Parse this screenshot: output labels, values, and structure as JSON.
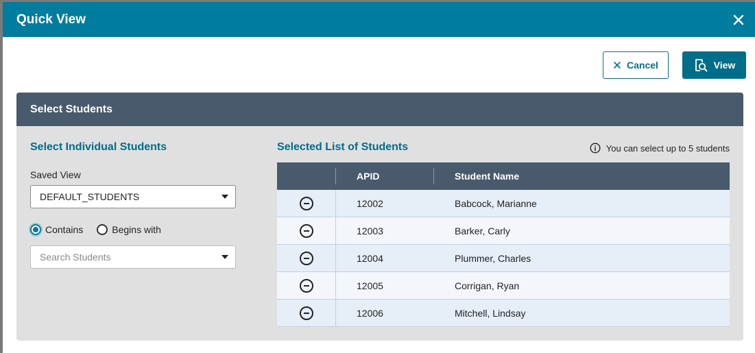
{
  "modal": {
    "title": "Quick View",
    "close_icon": "close-icon"
  },
  "toolbar": {
    "cancel_label": "Cancel",
    "view_label": "View"
  },
  "panel": {
    "header": "Select Students",
    "left": {
      "title": "Select Individual Students",
      "saved_view_label": "Saved View",
      "saved_view_value": "DEFAULT_STUDENTS",
      "radio_contains": "Contains",
      "radio_begins_with": "Begins with",
      "selected_radio": "Contains",
      "search_placeholder": "Search Students"
    },
    "right": {
      "title": "Selected List of Students",
      "info_note": "You can select up to 5 students",
      "columns": [
        "",
        "APID",
        "Student Name"
      ],
      "rows": [
        {
          "apid": "12002",
          "name": "Babcock, Marianne"
        },
        {
          "apid": "12003",
          "name": "Barker, Carly"
        },
        {
          "apid": "12004",
          "name": "Plummer, Charles"
        },
        {
          "apid": "12005",
          "name": "Corrigan, Ryan"
        },
        {
          "apid": "12006",
          "name": "Mitchell, Lindsay"
        }
      ]
    }
  },
  "colors": {
    "accent": "#007c9e",
    "header_dark": "#485a6c",
    "panel_bg": "#e0e0e0"
  }
}
